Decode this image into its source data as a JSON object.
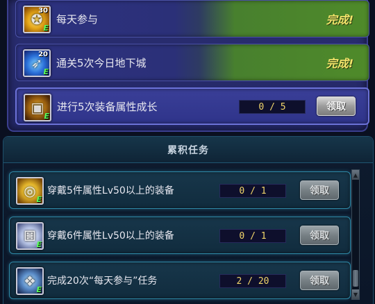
{
  "daily_tasks": [
    {
      "label": "每天参与",
      "status": "完成!",
      "icon": "gold-medal-icon",
      "icon_count": "30",
      "badge": "E"
    },
    {
      "label": "通关5次今日地下城",
      "status": "完成!",
      "icon": "blue-wing-icon",
      "icon_count": "20",
      "badge": "E"
    },
    {
      "label": "进行5次装备属性成长",
      "progress": "0 / 5",
      "claim": "领取",
      "icon": "treasure-chest-icon",
      "badge": "E"
    }
  ],
  "cumulative": {
    "title": "累积任务",
    "tasks": [
      {
        "label": "穿戴5件属性Lv50以上的装备",
        "progress": "0 / 1",
        "claim": "领取",
        "icon": "gold-ring-icon",
        "badge": "E"
      },
      {
        "label": "穿戴6件属性Lv50以上的装备",
        "progress": "0 / 1",
        "claim": "领取",
        "icon": "white-dice-icon",
        "badge": "E"
      },
      {
        "label": "完成20次“每天参与”任务",
        "progress": "2 / 20",
        "claim": "领取",
        "icon": "crystal-armor-icon",
        "badge": "E"
      }
    ]
  },
  "colors": {
    "done_text": "#f2e36a",
    "progress_text": "#f2d66a",
    "daily_bg": "#2a2e72",
    "cumul_border": "#2f8aa8"
  }
}
